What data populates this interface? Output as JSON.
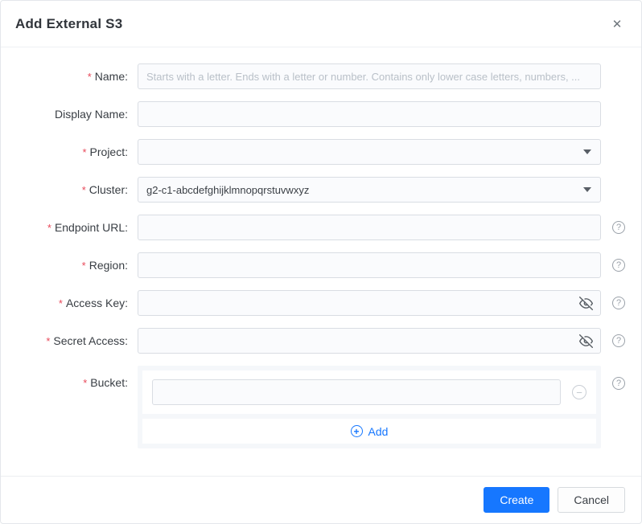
{
  "dialog": {
    "title": "Add External S3"
  },
  "icons": {
    "close": "✕",
    "help": "?",
    "minus": "−",
    "plus": "+"
  },
  "required_marker": "*",
  "fields": {
    "name": {
      "label": "Name:",
      "placeholder": "Starts with a letter. Ends with a letter or number. Contains only lower case letters, numbers, ...",
      "value": ""
    },
    "display_name": {
      "label": "Display Name:",
      "value": ""
    },
    "project": {
      "label": "Project:",
      "selected_value": ""
    },
    "cluster": {
      "label": "Cluster:",
      "selected_value": "g2-c1-abcdefghijklmnopqrstuvwxyz"
    },
    "endpoint_url": {
      "label": "Endpoint URL:",
      "value": ""
    },
    "region": {
      "label": "Region:",
      "value": ""
    },
    "access_key": {
      "label": "Access Key:",
      "value": ""
    },
    "secret_access": {
      "label": "Secret Access:",
      "value": ""
    },
    "bucket": {
      "label": "Bucket:",
      "items": [
        {
          "value": ""
        }
      ],
      "add_label": "Add"
    }
  },
  "footer": {
    "create_label": "Create",
    "cancel_label": "Cancel"
  },
  "colors": {
    "accent": "#1677ff",
    "required": "#e8495a"
  }
}
